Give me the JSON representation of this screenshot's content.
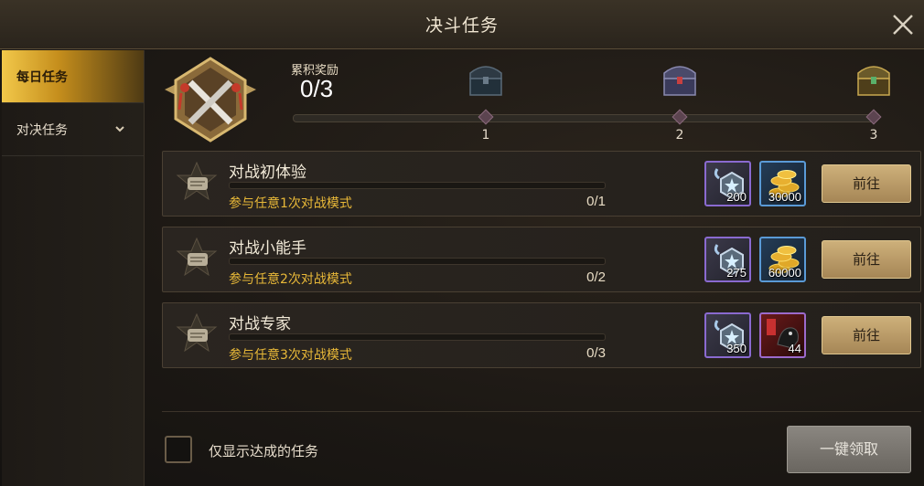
{
  "header": {
    "title": "决斗任务"
  },
  "sidebar": {
    "items": [
      {
        "label": "每日任务"
      },
      {
        "label": "对决任务"
      }
    ]
  },
  "progress": {
    "label": "累积奖励",
    "value": "0/3",
    "milestones": [
      {
        "number": "1",
        "icon": "dark-chest-icon"
      },
      {
        "number": "2",
        "icon": "steel-chest-icon"
      },
      {
        "number": "3",
        "icon": "gold-chest-icon"
      }
    ]
  },
  "tasks": [
    {
      "title": "对战初体验",
      "description": "参与任意1次对战模式",
      "count": "0/1",
      "progress": 0,
      "rewards": [
        {
          "icon": "hex-medal-icon",
          "quantity": "200"
        },
        {
          "icon": "gold-coins-icon",
          "quantity": "30000"
        }
      ],
      "button": "前往"
    },
    {
      "title": "对战小能手",
      "description": "参与任意2次对战模式",
      "count": "0/2",
      "progress": 0,
      "rewards": [
        {
          "icon": "hex-medal-icon",
          "quantity": "275"
        },
        {
          "icon": "gold-coins-icon",
          "quantity": "60000"
        }
      ],
      "button": "前往"
    },
    {
      "title": "对战专家",
      "description": "参与任意3次对战模式",
      "count": "0/3",
      "progress": 0,
      "rewards": [
        {
          "icon": "hex-medal-icon",
          "quantity": "350"
        },
        {
          "icon": "mount-card-icon",
          "quantity": "44"
        }
      ],
      "button": "前往"
    }
  ],
  "footer": {
    "checkbox_label": "仅显示达成的任务",
    "checkbox_checked": false,
    "claim_button": "一键领取"
  },
  "colors": {
    "accent_gold": "#e8b838",
    "active_tab": "#f2c84a",
    "button_gold": "#cdb07a",
    "button_disabled": "#8a8680"
  }
}
